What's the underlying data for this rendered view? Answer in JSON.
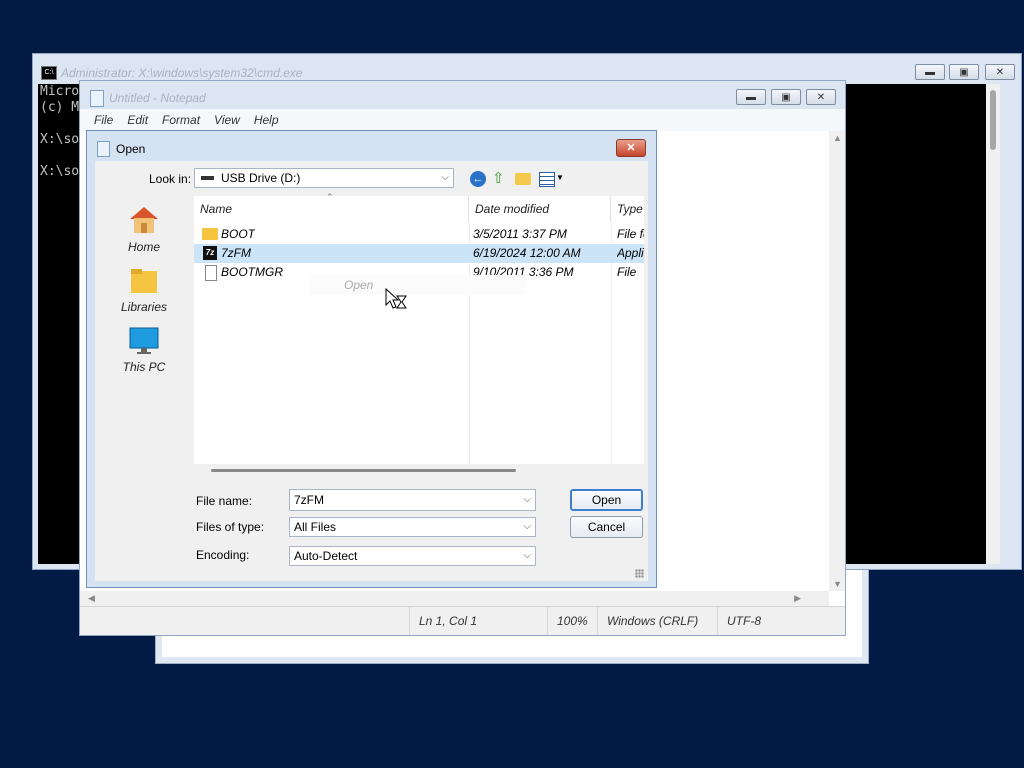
{
  "cmd": {
    "title": "Administrator: X:\\windows\\system32\\cmd.exe",
    "icon": "console-icon",
    "lines": [
      "Micro",
      "(c) M",
      "",
      "X:\\so",
      "",
      "X:\\so"
    ]
  },
  "notepad": {
    "title": "Untitled - Notepad",
    "icon": "notepad-icon",
    "menu": [
      "File",
      "Edit",
      "Format",
      "View",
      "Help"
    ],
    "status": {
      "position": "Ln 1, Col 1",
      "zoom": "100%",
      "line_ending": "Windows (CRLF)",
      "encoding": "UTF-8"
    }
  },
  "dialog": {
    "title": "Open",
    "look_in_label": "Look in:",
    "look_in_value": "USB Drive (D:)",
    "places": [
      "Home",
      "Libraries",
      "This PC"
    ],
    "columns": [
      "Name",
      "Date modified",
      "Type"
    ],
    "files": [
      {
        "name": "BOOT",
        "date": "3/5/2011 3:37 PM",
        "type": "File fo",
        "icon": "folder-icon"
      },
      {
        "name": "7zFM",
        "date": "6/19/2024 12:00 AM",
        "type": "Appli",
        "icon": "7zip-icon"
      },
      {
        "name": "BOOTMGR",
        "date": "9/10/2011 3:36 PM",
        "type": "File",
        "icon": "file-icon"
      }
    ],
    "tooltip": "Open",
    "file_name_label": "File name:",
    "file_name_value": "7zFM",
    "file_type_label": "Files of type:",
    "file_type_value": "All Files",
    "encoding_label": "Encoding:",
    "encoding_value": "Auto-Detect",
    "open_button": "Open",
    "cancel_button": "Cancel"
  },
  "colors": {
    "desktop": "#021a44",
    "selection": "#cce4f7",
    "console_bg": "#000000"
  }
}
